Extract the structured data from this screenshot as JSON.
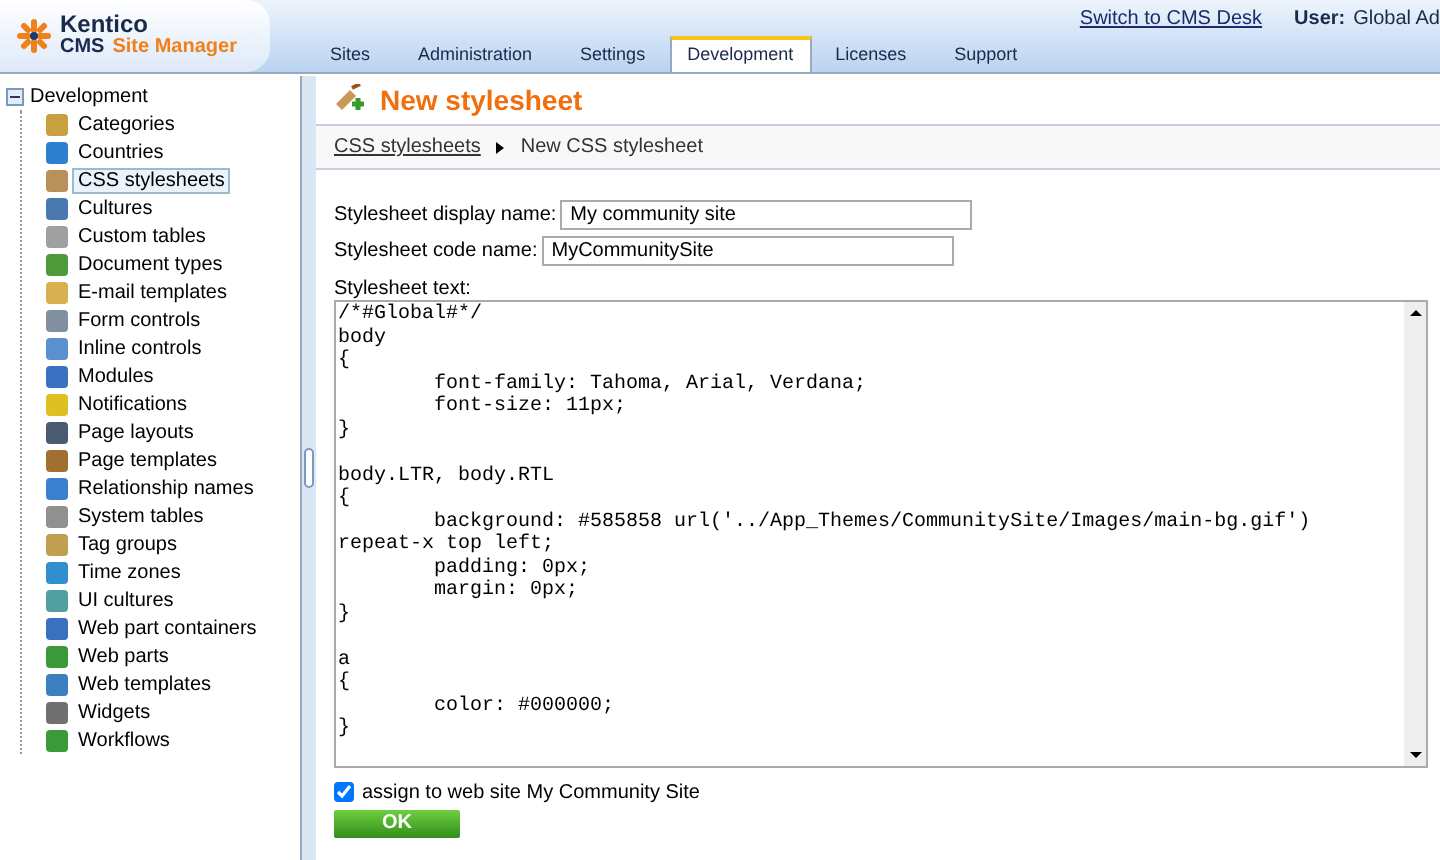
{
  "header": {
    "logo_name": "Kentico",
    "logo_product": "CMS",
    "logo_product_accent": "Site Manager",
    "switch_link": "Switch to CMS Desk",
    "user_label": "User:",
    "user_name": "Global Ad"
  },
  "tabs": [
    {
      "label": "Sites",
      "selected": false
    },
    {
      "label": "Administration",
      "selected": false
    },
    {
      "label": "Settings",
      "selected": false
    },
    {
      "label": "Development",
      "selected": true
    },
    {
      "label": "Licenses",
      "selected": false
    },
    {
      "label": "Support",
      "selected": false
    }
  ],
  "tree": {
    "label": "Development",
    "expanded": true,
    "children": [
      {
        "label": "Categories",
        "selected": false,
        "color": "#c8a040"
      },
      {
        "label": "Countries",
        "selected": false,
        "color": "#2f7fd0"
      },
      {
        "label": "CSS stylesheets",
        "selected": true,
        "color": "#b8905a"
      },
      {
        "label": "Cultures",
        "selected": false,
        "color": "#4a78b0"
      },
      {
        "label": "Custom tables",
        "selected": false,
        "color": "#a0a0a0"
      },
      {
        "label": "Document types",
        "selected": false,
        "color": "#4e9a3a"
      },
      {
        "label": "E-mail templates",
        "selected": false,
        "color": "#d8b050"
      },
      {
        "label": "Form controls",
        "selected": false,
        "color": "#8090a0"
      },
      {
        "label": "Inline controls",
        "selected": false,
        "color": "#5a90d0"
      },
      {
        "label": "Modules",
        "selected": false,
        "color": "#3a70c0"
      },
      {
        "label": "Notifications",
        "selected": false,
        "color": "#e0c020"
      },
      {
        "label": "Page layouts",
        "selected": false,
        "color": "#4a5a70"
      },
      {
        "label": "Page templates",
        "selected": false,
        "color": "#a07030"
      },
      {
        "label": "Relationship names",
        "selected": false,
        "color": "#3a80d0"
      },
      {
        "label": "System tables",
        "selected": false,
        "color": "#909090"
      },
      {
        "label": "Tag groups",
        "selected": false,
        "color": "#c0a050"
      },
      {
        "label": "Time zones",
        "selected": false,
        "color": "#2f8fd0"
      },
      {
        "label": "UI cultures",
        "selected": false,
        "color": "#50a0a0"
      },
      {
        "label": "Web part containers",
        "selected": false,
        "color": "#3a70c0"
      },
      {
        "label": "Web parts",
        "selected": false,
        "color": "#3a9a3a"
      },
      {
        "label": "Web templates",
        "selected": false,
        "color": "#3a80c0"
      },
      {
        "label": "Widgets",
        "selected": false,
        "color": "#707070"
      },
      {
        "label": "Workflows",
        "selected": false,
        "color": "#3a9a3a"
      }
    ]
  },
  "page": {
    "title": "New stylesheet",
    "breadcrumb": [
      {
        "label": "CSS stylesheets",
        "kind": "link"
      },
      {
        "label": "New CSS stylesheet",
        "kind": "text"
      }
    ]
  },
  "form": {
    "display_name_label": "Stylesheet display name:",
    "display_name_value": "My community site",
    "code_name_label": "Stylesheet code name:",
    "code_name_value": "MyCommunitySite",
    "text_label": "Stylesheet text:",
    "text_value": "/*#Global#*/\nbody\n{\n        font-family: Tahoma, Arial, Verdana;\n        font-size: 11px;\n}\n\nbody.LTR, body.RTL\n{\n        background: #585858 url('../App_Themes/CommunitySite/Images/main-bg.gif') repeat-x top left;\n        padding: 0px;\n        margin: 0px;\n}\n\na\n{\n        color: #000000;\n}",
    "assign_label": "assign to web site My Community Site",
    "assign_checked": true,
    "ok_button": "OK"
  }
}
